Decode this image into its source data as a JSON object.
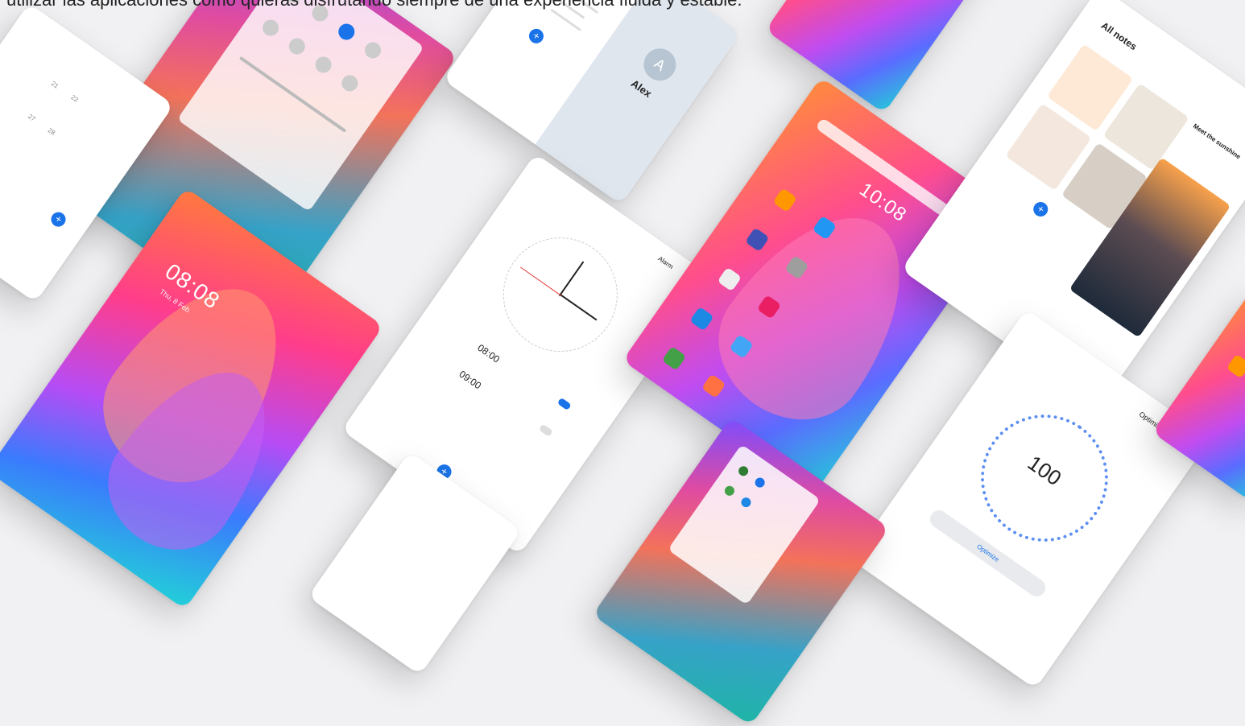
{
  "caption": "utilizar las aplicaciones como quieras disfrutando siempre de una experiencia fluida y estable.",
  "lock_screen": {
    "time": "08:08",
    "date": "Thu, 8 Feb"
  },
  "home_screen": {
    "time": "10:08"
  },
  "contacts": {
    "name": "Alex",
    "avatar_letter": "A"
  },
  "notes": {
    "title": "All notes",
    "detail_title": "Meet the sunshine"
  },
  "optimizer": {
    "title": "Optimizer",
    "score": "100",
    "button": "Optimize"
  },
  "clock": {
    "title": "Alarm",
    "alarm1": "08:00",
    "alarm2": "09:00"
  },
  "colors": {
    "accent": "#1a73e8",
    "background": "#f1f1f3"
  }
}
